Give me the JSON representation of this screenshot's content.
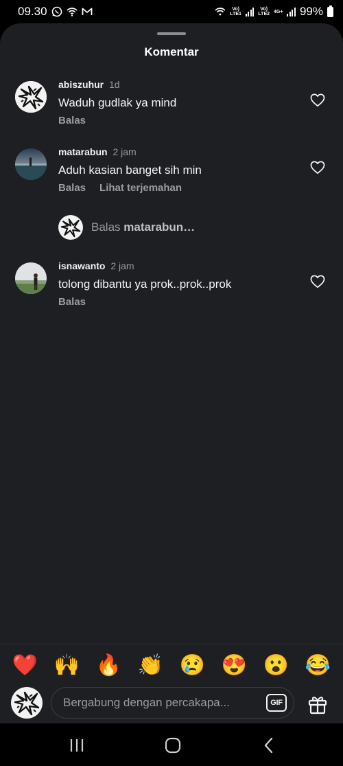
{
  "status_bar": {
    "time": "09.30",
    "sim1_label": "Vo)\nLTE1",
    "sim2_label": "Vo)\nLTE2",
    "network_type": "4G+",
    "battery_text": "99%"
  },
  "sheet": {
    "title": "Komentar"
  },
  "comments": [
    {
      "username": "abiszuhur",
      "time": "1d",
      "text": "Waduh gudlak ya mind",
      "actions": [
        "Balas"
      ]
    },
    {
      "username": "matarabun",
      "time": "2 jam",
      "text": "Aduh kasian banget sih min",
      "actions": [
        "Balas",
        "Lihat terjemahan"
      ]
    },
    {
      "username": "isnawanto",
      "time": "2 jam",
      "text": "tolong dibantu ya prok..prok..prok",
      "actions": [
        "Balas"
      ]
    }
  ],
  "reply_prompt": {
    "prefix": "Balas",
    "target": "matarabun…"
  },
  "emoji_bar": [
    "❤️",
    "🙌",
    "🔥",
    "👏",
    "😢",
    "😍",
    "😮",
    "😂"
  ],
  "composer": {
    "placeholder": "Bergabung dengan percakapa...",
    "gif_label": "GIF"
  },
  "colors": {
    "sheet_bg": "#1d1f23",
    "muted_text": "#9a9ca0",
    "primary_text": "#f5f5f5"
  }
}
